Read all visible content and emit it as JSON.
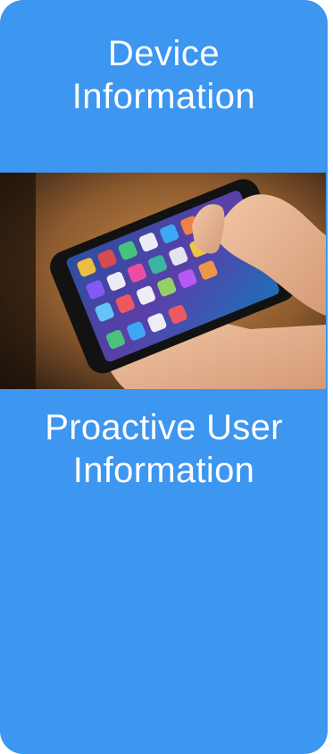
{
  "card": {
    "background": "#3d96f0",
    "top_title": "Device\nInformation",
    "bottom_title": "Proactive User\nInformation",
    "image": {
      "subject": "hand holding a smartphone showing home screen app icons"
    }
  }
}
